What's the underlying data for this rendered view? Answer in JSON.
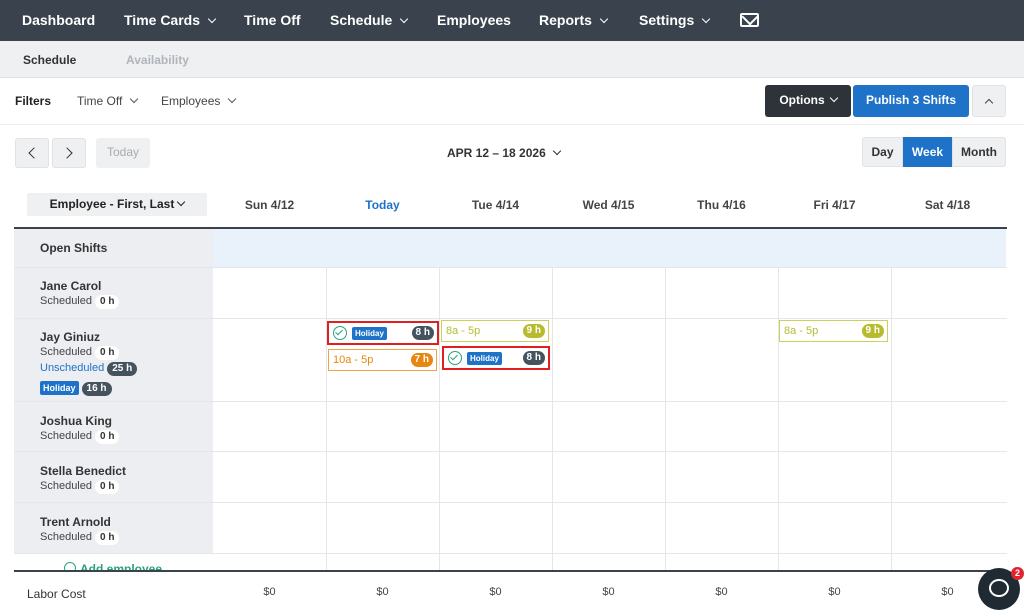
{
  "nav": {
    "items": [
      {
        "label": "Dashboard"
      },
      {
        "label": "Time Cards"
      },
      {
        "label": "Time Off"
      },
      {
        "label": "Schedule"
      },
      {
        "label": "Employees"
      },
      {
        "label": "Reports"
      },
      {
        "label": "Settings"
      }
    ],
    "mail_icon": "mail-icon"
  },
  "subnav": {
    "schedule": "Schedule",
    "availability": "Availability"
  },
  "filters": {
    "label": "Filters",
    "time_off": "Time Off",
    "employees": "Employees"
  },
  "actions": {
    "options": "Options",
    "publish": "Publish 3 Shifts"
  },
  "toolbar": {
    "today": "Today",
    "range": "APR 12 – 18 2026",
    "views": [
      "Day",
      "Week",
      "Month"
    ],
    "active_view": "Week"
  },
  "grid": {
    "sort": "Employee - First, Last",
    "days": [
      "Sun 4/12",
      "Today",
      "Tue 4/14",
      "Wed 4/15",
      "Thu 4/16",
      "Fri 4/17",
      "Sat 4/18"
    ],
    "open_shifts": "Open Shifts",
    "employees": [
      {
        "name": "Jane Carol",
        "scheduled_label": "Scheduled",
        "scheduled": "0 h"
      },
      {
        "name": "Jay Giniuz",
        "scheduled_label": "Scheduled",
        "scheduled": "0 h",
        "unscheduled_label": "Unscheduled",
        "unscheduled": "25 h",
        "holiday_label": "Holiday",
        "holiday": "16 h"
      },
      {
        "name": "Joshua King",
        "scheduled_label": "Scheduled",
        "scheduled": "0 h"
      },
      {
        "name": "Stella Benedict",
        "scheduled_label": "Scheduled",
        "scheduled": "0 h"
      },
      {
        "name": "Trent Arnold",
        "scheduled_label": "Scheduled",
        "scheduled": "0 h"
      }
    ],
    "add_employee": "Add employee",
    "shifts": {
      "holiday_mon": {
        "tag": "Holiday",
        "hours": "8 h"
      },
      "mon": {
        "time": "10a - 5p",
        "hours": "7 h"
      },
      "tue": {
        "time": "8a - 5p",
        "hours": "9 h"
      },
      "holiday_tue": {
        "tag": "Holiday",
        "hours": "8 h"
      },
      "fri": {
        "time": "8a - 5p",
        "hours": "9 h"
      }
    }
  },
  "footer": {
    "labor_label": "Labor Cost",
    "labor": [
      "$0",
      "$0",
      "$0",
      "$0",
      "$0",
      "$0",
      "$0"
    ]
  },
  "chat": {
    "badge": "2"
  },
  "colors": {
    "nav_bg": "#3a434d",
    "accent": "#1e73c9",
    "options_bg": "#2d3338",
    "shift_yellow": "#b6bc2e",
    "shift_orange": "#e8870f",
    "holiday_border": "#e02020",
    "check_green": "#2aa37a"
  }
}
